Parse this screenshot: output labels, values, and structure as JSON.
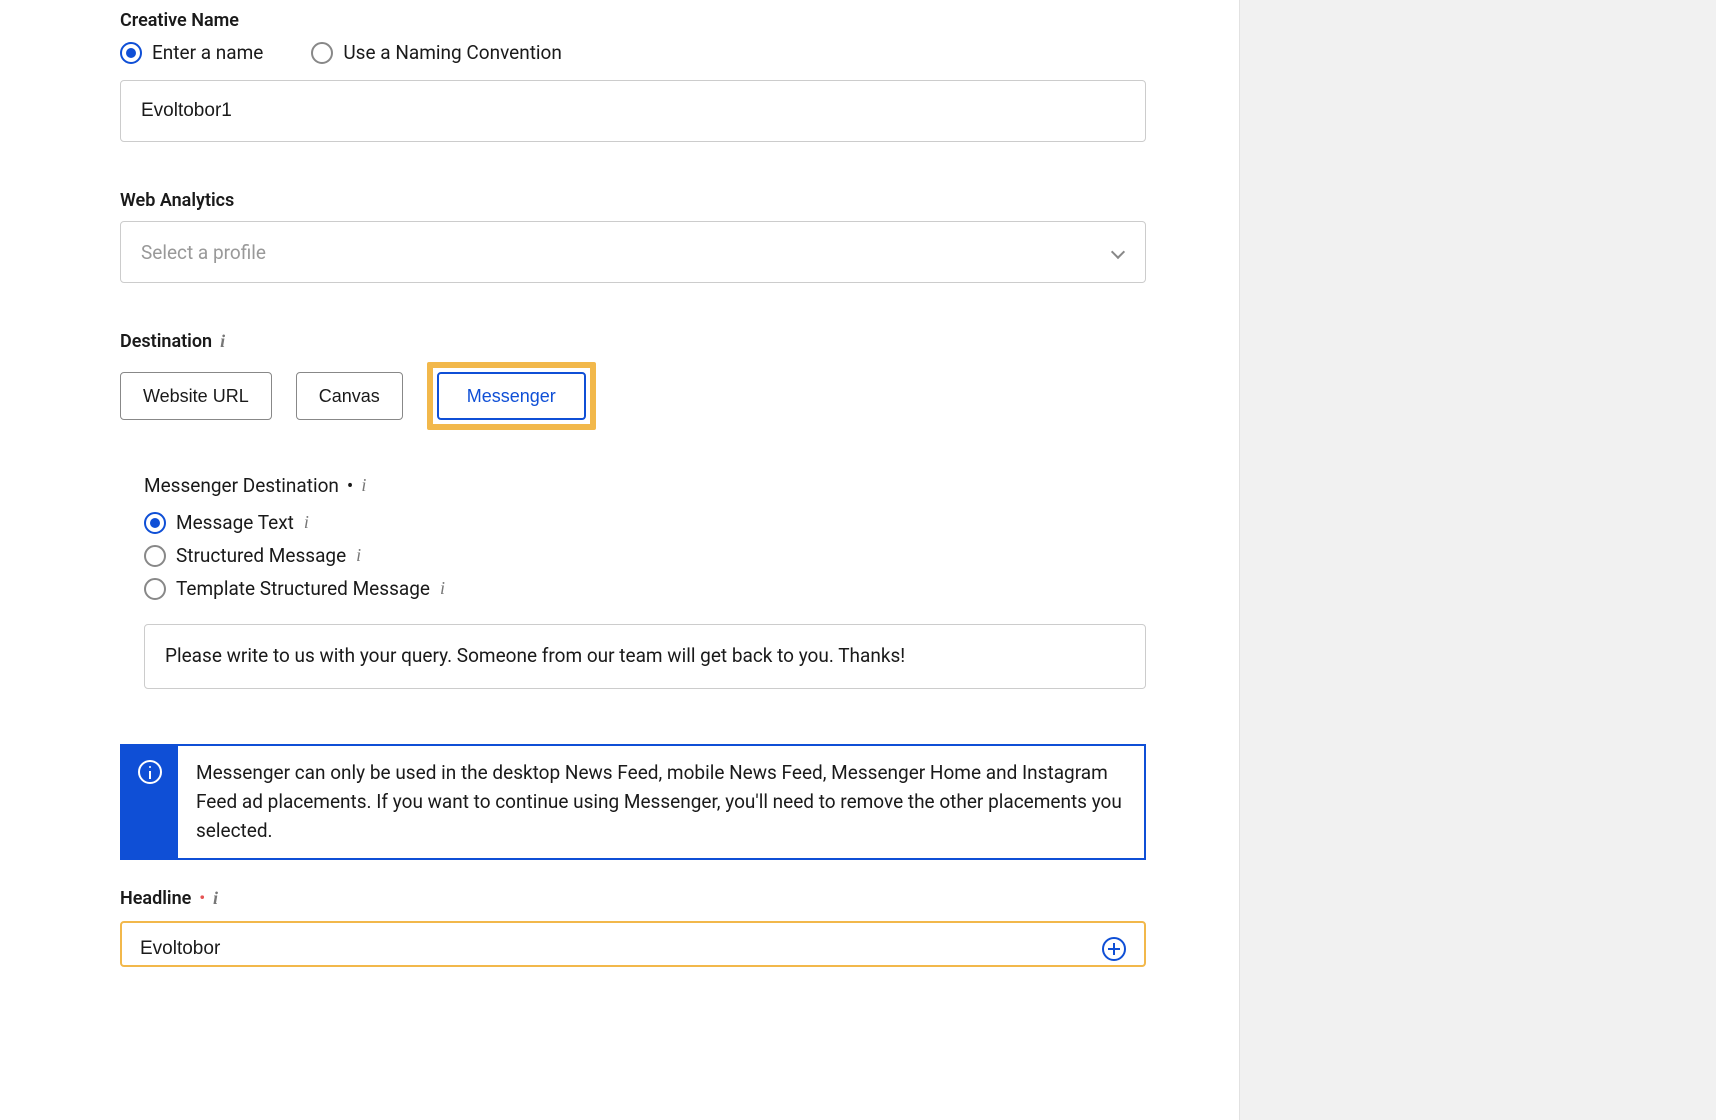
{
  "creativeName": {
    "label": "Creative Name",
    "radios": {
      "enterName": "Enter a name",
      "namingConvention": "Use a Naming Convention"
    },
    "value": "Evoltobor1"
  },
  "webAnalytics": {
    "label": "Web Analytics",
    "placeholder": "Select a profile"
  },
  "destination": {
    "label": "Destination",
    "buttons": {
      "websiteUrl": "Website URL",
      "canvas": "Canvas",
      "messenger": "Messenger"
    }
  },
  "messengerDestination": {
    "label": "Messenger Destination",
    "radios": {
      "messageText": "Message Text",
      "structured": "Structured Message",
      "templateStructured": "Template Structured Message"
    },
    "textValue": "Please write to us with your query. Someone from our team will get back to you. Thanks!"
  },
  "infoBanner": {
    "text": "Messenger can only be used in the desktop News Feed, mobile News Feed, Messenger Home and Instagram Feed ad placements. If you want to continue using Messenger, you'll need to remove the other placements you selected."
  },
  "headline": {
    "label": "Headline",
    "value": "Evoltobor"
  }
}
